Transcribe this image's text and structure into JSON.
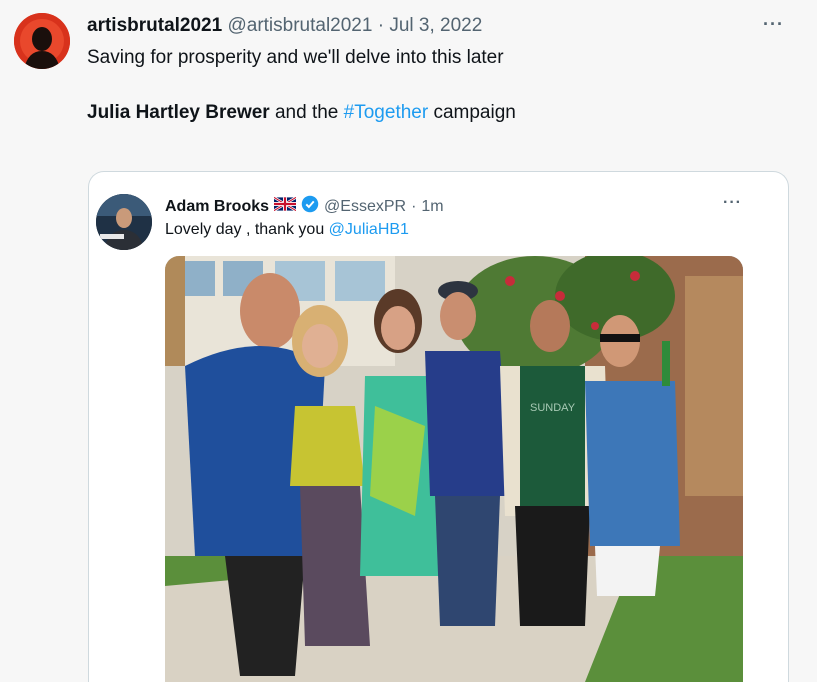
{
  "tweet": {
    "author_name": "artisbrutal2021",
    "handle": "@artisbrutal2021",
    "separator": "·",
    "date": "Jul 3, 2022",
    "more_label": "···",
    "line1": "Saving for prosperity and we'll delve into this later",
    "line2_bold": "Julia Hartley Brewer",
    "line2_mid": "and the",
    "line2_hashtag": "#Together",
    "line2_end": "campaign"
  },
  "quote": {
    "author_name": "Adam Brooks",
    "flag_icon": "uk-flag-icon",
    "verified_icon": "verified-badge-icon",
    "handle": "@EssexPR",
    "separator": "·",
    "time": "1m",
    "more_label": "···",
    "text": "Lovely day , thank you",
    "mention": "@JuliaHB1",
    "photo_shirt_text": "SUNDAY"
  },
  "colors": {
    "link": "#1d9bf0",
    "muted": "#536471",
    "verified": "#1d9bf0",
    "border": "#cfd9de"
  }
}
